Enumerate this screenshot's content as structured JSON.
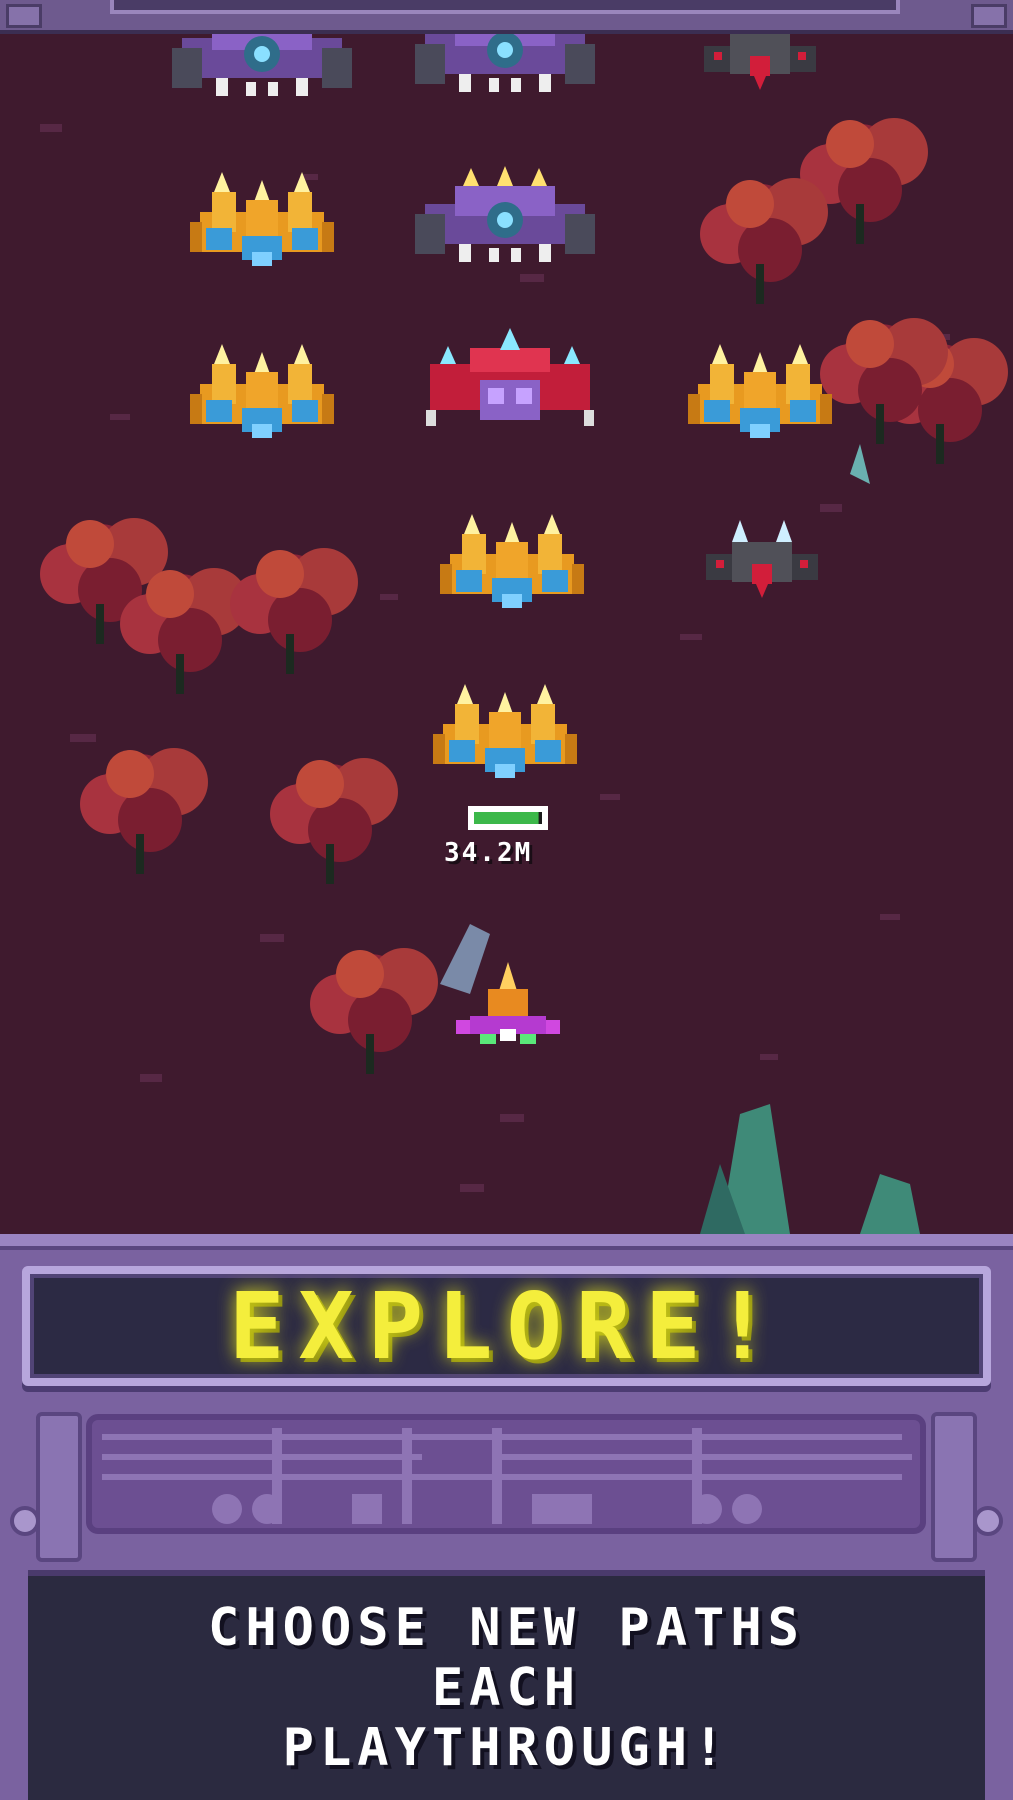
{
  "hud": {
    "enemy_score": "34.2M",
    "enemy_health_fraction": 0.95
  },
  "banner": {
    "title": "EXPLORE!"
  },
  "caption": {
    "lines": [
      "CHOOSE NEW PATHS",
      "EACH",
      "PLAYTHROUGH!"
    ]
  },
  "colors": {
    "ground": "#3f1a2e",
    "banner_text": "#f4ee3c",
    "panel": "#7a62a0",
    "health_bar": "#3cb84a"
  },
  "sprites": {
    "enemies": [
      "gold-blue-fighter",
      "purple-gunship",
      "red-assault-ship",
      "dark-spider-ship"
    ],
    "player": "player-ship-icon",
    "terrain": [
      "red-tree-cluster",
      "crystal-rock"
    ]
  }
}
